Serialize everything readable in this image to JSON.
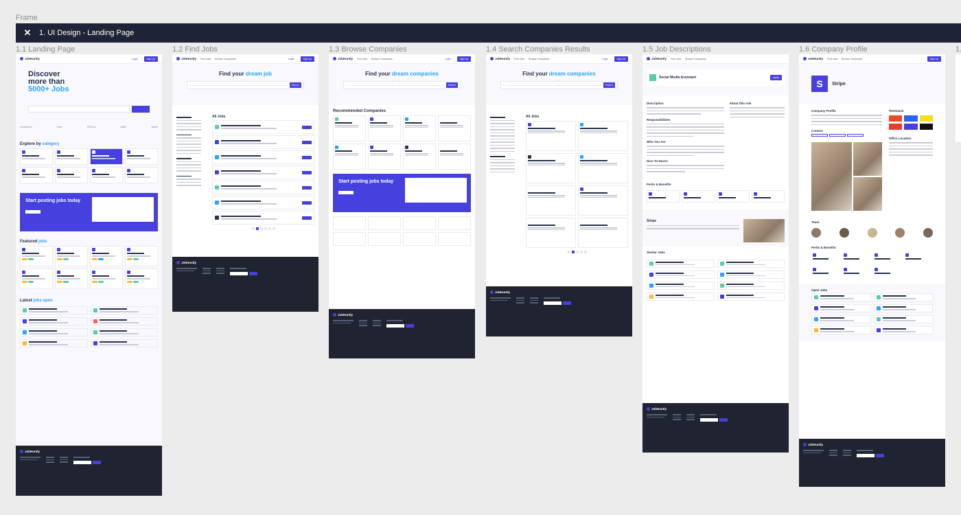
{
  "canvas": {
    "label": "Frame"
  },
  "section": {
    "title": "1. UI Design - Landing Page",
    "icon": "close-icon"
  },
  "frames": [
    {
      "label": "1.1 Landing Page"
    },
    {
      "label": "1.2 Find Jobs"
    },
    {
      "label": "1.3 Browse Companies"
    },
    {
      "label": "1.4 Search Companies Results"
    },
    {
      "label": "1.5 Job Descriptions"
    },
    {
      "label": "1.6 Company Profile"
    },
    {
      "label": "1."
    }
  ],
  "brand": "JobHuntly",
  "landing": {
    "hero_line1": "Discover",
    "hero_line2": "more than",
    "hero_line3": "5000+ Jobs",
    "category_title": "Explore by",
    "category_blue": "category",
    "cta_title": "Start posting jobs today",
    "featured_title": "Featured",
    "featured_blue": "jobs",
    "latest_title": "Latest",
    "latest_blue": "jobs open",
    "logos": [
      "vodafone",
      "intel",
      "TESLA",
      "AMD",
      "Talkit"
    ]
  },
  "find_jobs": {
    "heading": "Find your",
    "heading_blue": "dream job",
    "list_title": "All Jobs"
  },
  "browse": {
    "heading": "Find your",
    "heading_blue": "dream companies",
    "rec_title": "Recommended Companies",
    "cta_title": "Start posting jobs today"
  },
  "search_results": {
    "heading": "Find your",
    "heading_blue": "dream companies",
    "list_title": "All Jobs"
  },
  "job_desc": {
    "title": "Social Media Assistant",
    "apply": "Apply",
    "sections": [
      "Description",
      "Responsibilities",
      "Who You Are",
      "Nice-To-Haves",
      "Perks & Benefits",
      "Similar Jobs"
    ],
    "about": "About this role",
    "company": "Stripe"
  },
  "company_profile": {
    "name": "Stripe",
    "sections": [
      "Company Profile",
      "Contact",
      "Team",
      "Perks & Benefits",
      "Open Jobs"
    ],
    "techstack": "Techstack",
    "office": "Office Location"
  }
}
